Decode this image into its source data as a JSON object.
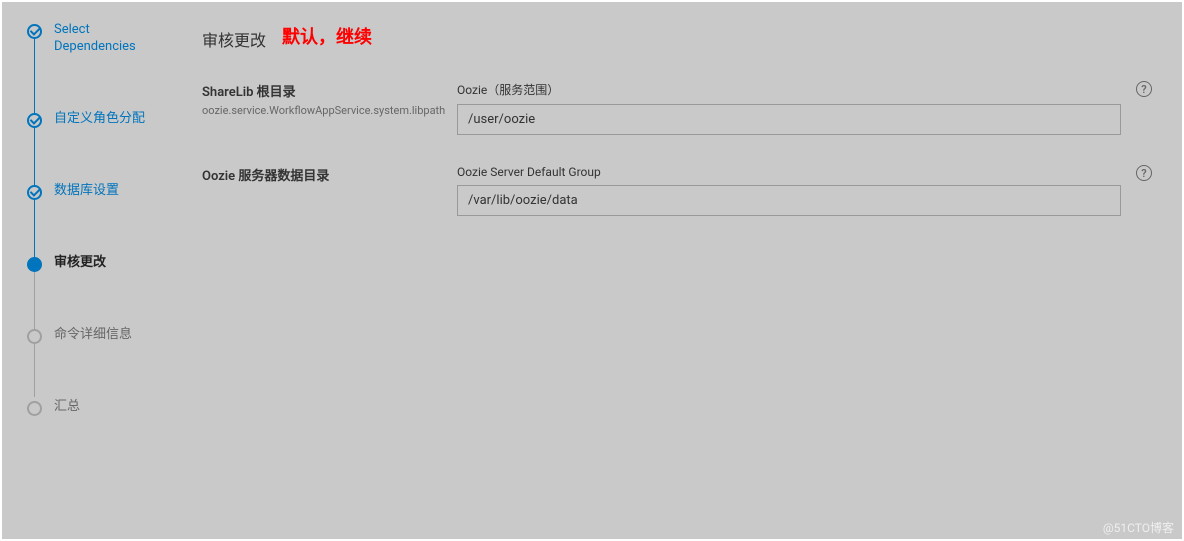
{
  "sidebar": {
    "steps": [
      {
        "label": "Select\nDependencies",
        "state": "done"
      },
      {
        "label": "自定义角色分配",
        "state": "done"
      },
      {
        "label": "数据库设置",
        "state": "done"
      },
      {
        "label": "审核更改",
        "state": "active"
      },
      {
        "label": "命令详细信息",
        "state": "pending"
      },
      {
        "label": "汇总",
        "state": "pending"
      }
    ]
  },
  "page": {
    "title": "审核更改",
    "annotation": "默认，继续"
  },
  "config": [
    {
      "label": "ShareLib 根目录",
      "subtext": "oozie.service.WorkflowAppService.system.libpath",
      "field_label": "Oozie（服务范围）",
      "value": "/user/oozie"
    },
    {
      "label": "Oozie 服务器数据目录",
      "subtext": "",
      "field_label": "Oozie Server Default Group",
      "value": "/var/lib/oozie/data"
    }
  ],
  "watermark": "@51CTO博客"
}
